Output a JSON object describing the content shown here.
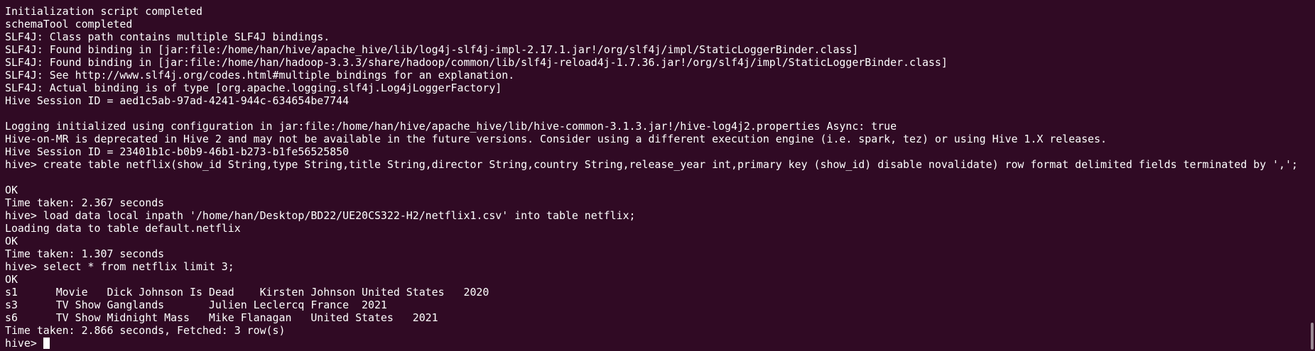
{
  "terminal": {
    "lines": [
      "Initialization script completed",
      "schemaTool completed",
      "SLF4J: Class path contains multiple SLF4J bindings.",
      "SLF4J: Found binding in [jar:file:/home/han/hive/apache_hive/lib/log4j-slf4j-impl-2.17.1.jar!/org/slf4j/impl/StaticLoggerBinder.class]",
      "SLF4J: Found binding in [jar:file:/home/han/hadoop-3.3.3/share/hadoop/common/lib/slf4j-reload4j-1.7.36.jar!/org/slf4j/impl/StaticLoggerBinder.class]",
      "SLF4J: See http://www.slf4j.org/codes.html#multiple_bindings for an explanation.",
      "SLF4J: Actual binding is of type [org.apache.logging.slf4j.Log4jLoggerFactory]",
      "Hive Session ID = aed1c5ab-97ad-4241-944c-634654be7744",
      "",
      "Logging initialized using configuration in jar:file:/home/han/hive/apache_hive/lib/hive-common-3.1.3.jar!/hive-log4j2.properties Async: true",
      "Hive-on-MR is deprecated in Hive 2 and may not be available in the future versions. Consider using a different execution engine (i.e. spark, tez) or using Hive 1.X releases.",
      "Hive Session ID = 23401b1c-b0b9-46b1-b273-b1fe56525850",
      "hive> create table netflix(show_id String,type String,title String,director String,country String,release_year int,primary key (show_id) disable novalidate) row format delimited fields terminated by ',';",
      "",
      "OK",
      "Time taken: 2.367 seconds",
      "hive> load data local inpath '/home/han/Desktop/BD22/UE20CS322-H2/netflix1.csv' into table netflix;",
      "Loading data to table default.netflix",
      "OK",
      "Time taken: 1.307 seconds",
      "hive> select * from netflix limit 3;",
      "OK",
      "s1      Movie   Dick Johnson Is Dead    Kirsten Johnson United States   2020",
      "s3      TV Show Ganglands       Julien Leclercq France  2021",
      "s6      TV Show Midnight Mass   Mike Flanagan   United States   2021",
      "Time taken: 2.866 seconds, Fetched: 3 row(s)"
    ],
    "prompt": "hive> "
  },
  "colors": {
    "background": "#300a24",
    "foreground": "#ffffff"
  }
}
